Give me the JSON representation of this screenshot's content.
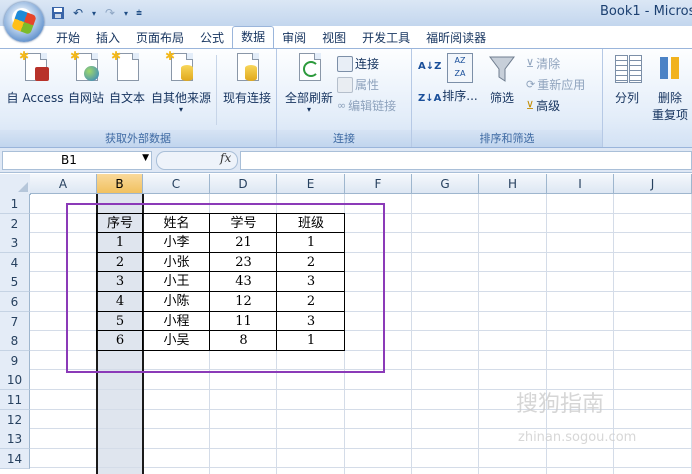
{
  "window": {
    "book_title": "Book1 - Micros"
  },
  "quick_access": [
    "save-icon",
    "undo-icon",
    "redo-icon",
    "customize-icon"
  ],
  "tabs": [
    "开始",
    "插入",
    "页面布局",
    "公式",
    "数据",
    "审阅",
    "视图",
    "开发工具",
    "福昕阅读器"
  ],
  "active_tab": "数据",
  "ribbon": {
    "get_external": {
      "label": "获取外部数据",
      "buttons": [
        "自 Access",
        "自网站",
        "自文本",
        "自其他来源",
        "现有连接"
      ]
    },
    "connections": {
      "label": "连接",
      "refresh_all": "全部刷新",
      "connections": "连接",
      "properties": "属性",
      "edit_links": "编辑链接"
    },
    "sort_filter": {
      "label": "排序和筛选",
      "sort": "排序...",
      "filter": "筛选",
      "clear": "清除",
      "reapply": "重新应用",
      "advanced": "高级"
    },
    "data_tools": {
      "text_to_columns": "分列",
      "remove_duplicates_1": "删除",
      "remove_duplicates_2": "重复项"
    }
  },
  "formula_bar": {
    "name_box": "B1",
    "fx": "fx",
    "value": ""
  },
  "sheet": {
    "columns": [
      "A",
      "B",
      "C",
      "D",
      "E",
      "F",
      "G",
      "H",
      "I",
      "J"
    ],
    "selected_column": "B",
    "rows": [
      "1",
      "2",
      "3",
      "4",
      "5",
      "6",
      "7",
      "8",
      "9",
      "10",
      "11",
      "12",
      "13",
      "14"
    ],
    "table": {
      "header": [
        "序号",
        "姓名",
        "学号",
        "班级"
      ],
      "rows": [
        [
          "1",
          "小李",
          "21",
          "1"
        ],
        [
          "2",
          "小张",
          "23",
          "2"
        ],
        [
          "3",
          "小王",
          "43",
          "3"
        ],
        [
          "4",
          "小陈",
          "12",
          "2"
        ],
        [
          "5",
          "小程",
          "11",
          "3"
        ],
        [
          "6",
          "小吴",
          "8",
          "1"
        ]
      ]
    }
  },
  "watermark": {
    "main": "搜狗指南",
    "sub": "zhinan.sogou.com"
  },
  "colors": {
    "highlight_box": "#8b3ab8",
    "selected_header": "#f1c15f"
  }
}
